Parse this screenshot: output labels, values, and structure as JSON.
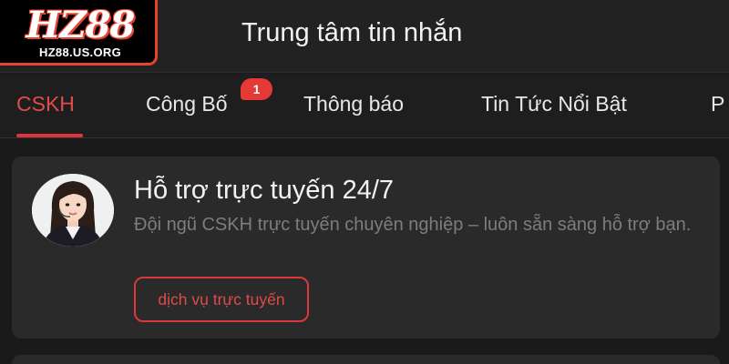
{
  "header": {
    "logo_main": "HZ88",
    "logo_sub": "HZ88.US.ORG",
    "title": "Trung tâm tin nhắn"
  },
  "tabs": [
    {
      "label": "CSKH",
      "active": true
    },
    {
      "label": "Công Bố",
      "badge": "1"
    },
    {
      "label": "Thông báo"
    },
    {
      "label": "Tin Tức Nổi Bật"
    },
    {
      "label": "P"
    }
  ],
  "card": {
    "title": "Hỗ trợ trực tuyến 24/7",
    "description": "Đội ngũ CSKH trực tuyến chuyên nghiệp – luôn sẵn sàng hỗ trợ bạn.",
    "button_label": "dịch vụ trực tuyến"
  },
  "colors": {
    "accent": "#e0343b",
    "background": "#1a1a1a",
    "card": "#2a2a2a"
  }
}
